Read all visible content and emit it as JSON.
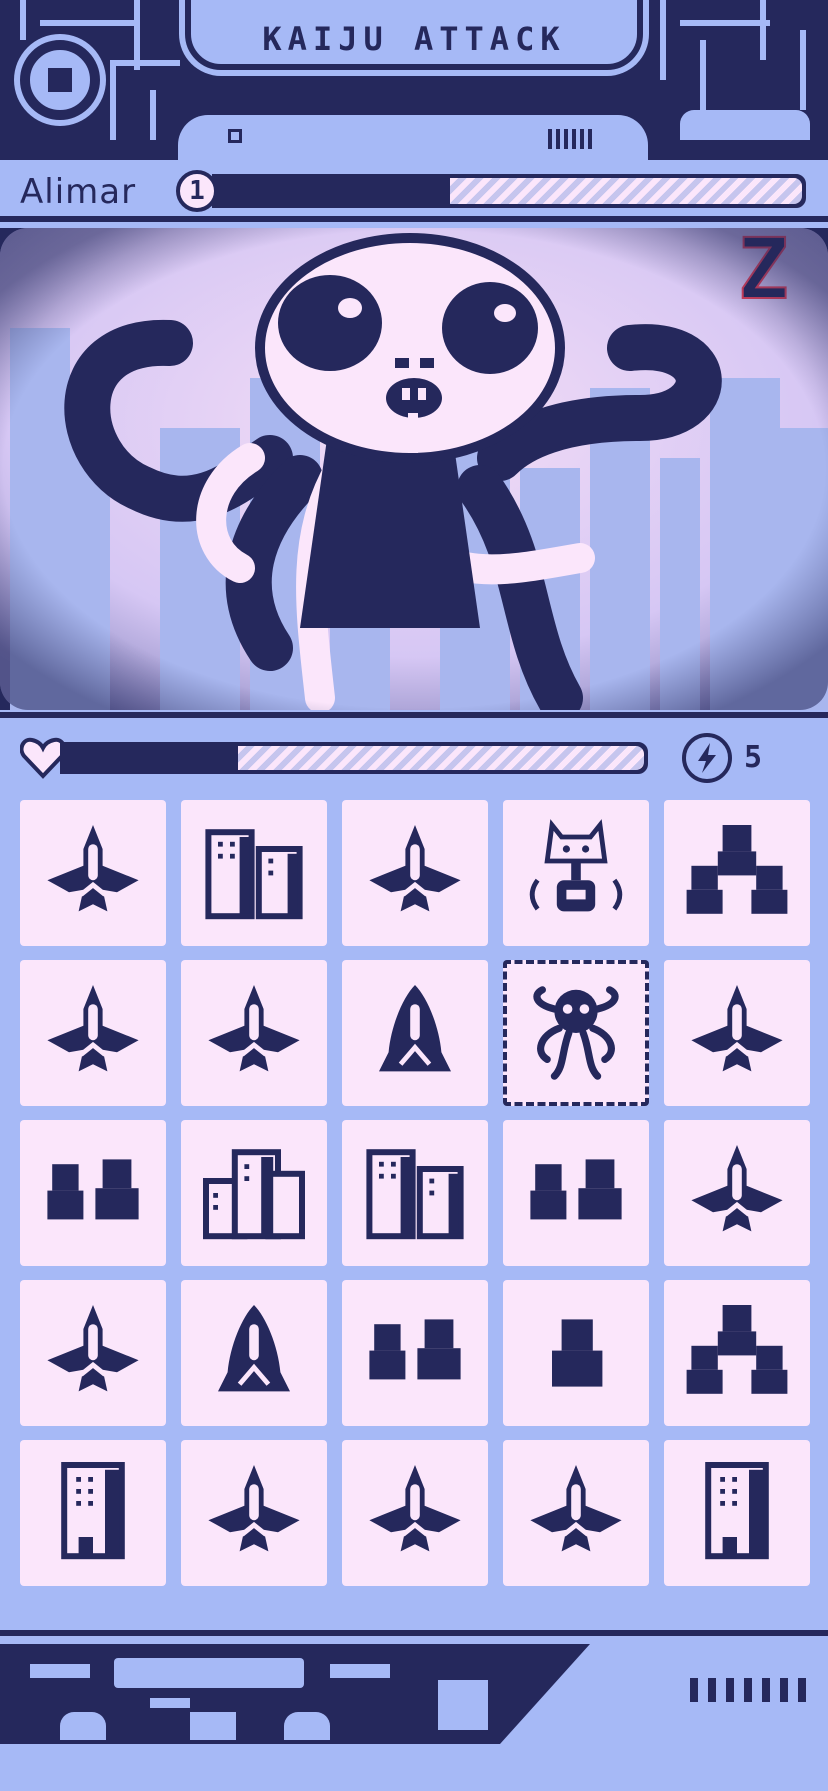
{
  "game": {
    "title": "KAIJU ATTACK"
  },
  "player": {
    "name": "Alimar",
    "level": "1",
    "xp_fraction": 0.4
  },
  "scene": {
    "sleep_indicator": "Z",
    "monster": "alien-octopus-kaiju"
  },
  "stats": {
    "health_fraction": 0.3,
    "energy_count": "5"
  },
  "board": {
    "rows": 5,
    "cols": 5,
    "tiles": [
      "jet-icon",
      "buildings-icon",
      "jet-icon",
      "robot-cat-icon",
      "people-group-icon",
      "jet-icon",
      "jet-icon",
      "rocket-icon",
      "octopus-kaiju-icon",
      "jet-icon",
      "people-pair-icon",
      "city-block-icon",
      "buildings-icon",
      "people-pair-icon",
      "jet-icon",
      "jet-icon",
      "rocket-icon",
      "people-pair-icon",
      "person-icon",
      "people-group-icon",
      "building-icon",
      "jet-icon",
      "jet-icon",
      "jet-icon",
      "building-icon"
    ],
    "selected_index": 8
  },
  "colors": {
    "dark": "#25285c",
    "light": "#a6b9f6",
    "tile": "#fbe6fb"
  }
}
